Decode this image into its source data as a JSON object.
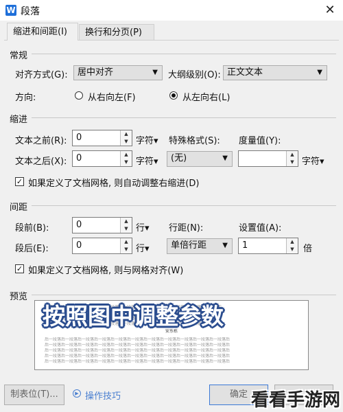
{
  "window": {
    "title": "段落",
    "app_icon_letter": "W",
    "close_glyph": "✕"
  },
  "tabs": [
    {
      "label": "缩进和间距(I)"
    },
    {
      "label": "换行和分页(P)"
    }
  ],
  "general": {
    "section": "常规",
    "align_label": "对齐方式(G):",
    "align_value": "居中对齐",
    "outline_label": "大纲级别(O):",
    "outline_value": "正文文本",
    "direction_label": "方向:",
    "rtl_label": "从右向左(F)",
    "ltr_label": "从左向右(L)"
  },
  "indent": {
    "section": "缩进",
    "before_label": "文本之前(R):",
    "before_value": "0",
    "before_unit": "字符▾",
    "special_label": "特殊格式(S):",
    "measure_label": "度量值(Y):",
    "after_label": "文本之后(X):",
    "after_value": "0",
    "after_unit": "字符▾",
    "special_value": "(无)",
    "measure_value": "",
    "measure_unit": "字符▾",
    "grid_check": "如果定义了文档网格, 则自动调整右缩进(D)"
  },
  "spacing": {
    "section": "间距",
    "before_label": "段前(B):",
    "before_value": "0",
    "before_unit": "行▾",
    "line_label": "行距(N):",
    "set_label": "设置值(A):",
    "after_label": "段后(E):",
    "after_value": "0",
    "after_unit": "行▾",
    "line_value": "单倍行距",
    "set_value": "1",
    "set_unit": "倍",
    "grid_check": "如果定义了文档网格, 则与网格对齐(W)"
  },
  "preview": {
    "section": "预览",
    "line_text": "段落前一段落前一段落前一段落前一段落前一段落前一段落前一段落前一段落前一段落前一段落前",
    "sample_text": "安东栋",
    "after_text": "后一段落后一段落后一段落后一段落后一段落后一段落后一段落后一段落后一段落后一段落后一段落后"
  },
  "overlay": {
    "banner": "按照图中调整参数",
    "watermark": "看看手游网"
  },
  "footer": {
    "tabs_button": "制表位(T)...",
    "tips_link": "操作技巧",
    "ok_button": "确定"
  },
  "colors": {
    "accent": "#1e6fd9",
    "banner_outline": "#2b4d8f"
  }
}
